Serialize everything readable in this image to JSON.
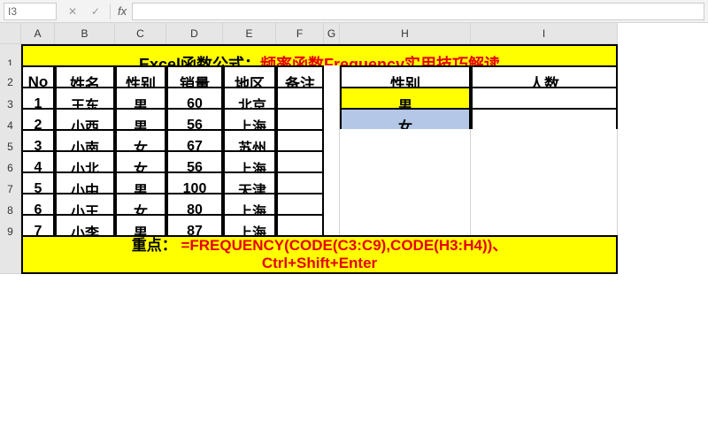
{
  "name_box": "I3",
  "fx_label": "fx",
  "col_headers": [
    "A",
    "B",
    "C",
    "D",
    "E",
    "F",
    "G",
    "H",
    "I"
  ],
  "row_headers": [
    "1",
    "2",
    "3",
    "4",
    "5",
    "6",
    "7",
    "8",
    "9"
  ],
  "title_black": "Excel函数公式：",
  "title_red": "频率函数Frequency实用技巧解读",
  "main_headers": {
    "no": "No",
    "name": "姓名",
    "gender": "性别",
    "sales": "销量",
    "region": "地区",
    "note": "备注"
  },
  "rows": [
    {
      "no": "1",
      "name": "王东",
      "gender": "男",
      "sales": "60",
      "region": "北京",
      "note": ""
    },
    {
      "no": "2",
      "name": "小西",
      "gender": "男",
      "sales": "56",
      "region": "上海",
      "note": ""
    },
    {
      "no": "3",
      "name": "小南",
      "gender": "女",
      "sales": "67",
      "region": "苏州",
      "note": ""
    },
    {
      "no": "4",
      "name": "小北",
      "gender": "女",
      "sales": "56",
      "region": "上海",
      "note": ""
    },
    {
      "no": "5",
      "name": "小中",
      "gender": "男",
      "sales": "100",
      "region": "天津",
      "note": ""
    },
    {
      "no": "6",
      "name": "小王",
      "gender": "女",
      "sales": "80",
      "region": "上海",
      "note": ""
    },
    {
      "no": "7",
      "name": "小李",
      "gender": "男",
      "sales": "87",
      "region": "上海",
      "note": ""
    }
  ],
  "side": {
    "gender": "性别",
    "count": "人数",
    "male": "男",
    "female": "女"
  },
  "footer_black": "重点：",
  "footer_red": "=FREQUENCY(CODE(C3:C9),CODE(H3:H4))、",
  "footer_line2": "Ctrl+Shift+Enter"
}
